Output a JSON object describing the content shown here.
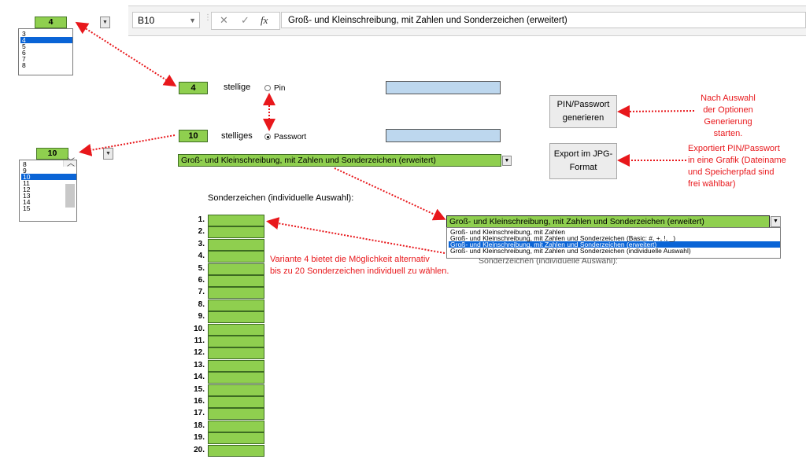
{
  "formula_bar": {
    "name_box": "B10",
    "cancel_icon": "✕",
    "enter_icon": "✓",
    "fx_label": "fx",
    "formula": "Groß- und Kleinschreibung, mit Zahlen und Sonderzeichen (erweitert)"
  },
  "pin_length_dropdown": {
    "value": "4",
    "options": [
      "3",
      "4",
      "5",
      "6",
      "7",
      "8"
    ],
    "selected_index": 1
  },
  "password_length_dropdown": {
    "value": "10",
    "options": [
      "8",
      "9",
      "10",
      "11",
      "12",
      "13",
      "14",
      "15"
    ],
    "selected_index": 2
  },
  "main": {
    "pin_digits": "4",
    "pin_digits_label": "stellige",
    "pin_radio": "Pin",
    "password_digits": "10",
    "password_digits_label": "stelliges",
    "password_radio": "Passwort",
    "selected_mode": "Passwort",
    "variant_value": "Groß- und Kleinschreibung, mit Zahlen und Sonderzeichen (erweitert)",
    "special_chars_title": "Sonderzeichen (individuelle Auswahl):"
  },
  "variant_dropdown": {
    "value": "Groß- und Kleinschreibung, mit Zahlen und Sonderzeichen (erweitert)",
    "options": [
      "Groß- und Kleinschreibung, mit Zahlen",
      "Groß- und Kleinschreibung, mit Zahlen und Sonderzeichen (Basic: #, +, !, _)",
      "Groß- und Kleinschreibung, mit Zahlen und Sonderzeichen (erweitert)",
      "Groß- und Kleinschreibung, mit Zahlen und Sonderzeichen (individuelle Auswahl)"
    ],
    "selected_index": 2,
    "hidden_behind_text": "Sonderzeichen (individuelle Auswahl):"
  },
  "buttons": {
    "generate": "PIN/Passwort generieren",
    "generate_line1": "PIN/Passwort",
    "generate_line2": "generieren",
    "export_line1": "Export im JPG-",
    "export_line2": "Format"
  },
  "annotations": {
    "generate_note": [
      "Nach Auswahl",
      "der Optionen",
      "Generierung",
      "starten."
    ],
    "export_note": [
      "Exportiert PIN/Passwort",
      "in eine Grafik (Dateiname",
      "und Speicherpfad sind",
      "frei wählbar)"
    ],
    "variant_note": [
      "Variante 4 bietet die Möglichkeit alternativ",
      "bis zu 20 Sonderzeichen individuell zu wählen."
    ]
  },
  "special_char_rows": [
    "1.",
    "2.",
    "3.",
    "4.",
    "5.",
    "6.",
    "7.",
    "8.",
    "9.",
    "10.",
    "11.",
    "12.",
    "13.",
    "14.",
    "15.",
    "16.",
    "17.",
    "18.",
    "19.",
    "20."
  ],
  "colors": {
    "cell_green": "#8fcf4f",
    "cell_blue": "#bdd7ee",
    "annotation_red": "#e8171b",
    "selection_blue": "#0a64d6"
  }
}
